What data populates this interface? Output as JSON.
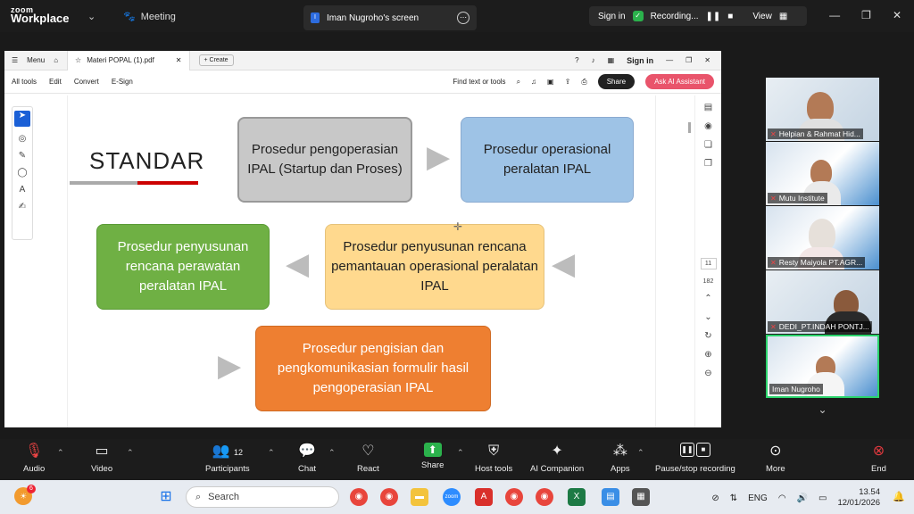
{
  "zoom": {
    "logo_top": "zoom",
    "logo_bottom": "Workplace",
    "meeting_label": "Meeting",
    "screen_tab_label": "Iman Nugroho's screen",
    "signin": "Sign in",
    "recording": "Recording...",
    "view": "View"
  },
  "pdf": {
    "menu": "Menu",
    "tab_name": "Materi POPAL (1).pdf",
    "create": "Create",
    "signin": "Sign in",
    "menus": [
      "All tools",
      "Edit",
      "Convert",
      "E-Sign"
    ],
    "find": "Find text or tools",
    "share": "Share",
    "ai": "Ask AI Assistant",
    "page_current": "11",
    "page_total": "182"
  },
  "slide": {
    "title": "STANDAR",
    "box1": "Prosedur pengoperasian IPAL (Startup dan Proses)",
    "box2": "Prosedur operasional peralatan IPAL",
    "box3": "Prosedur penyusunan rencana pemantauan operasional peralatan IPAL",
    "box4": "Prosedur penyusunan rencana perawatan peralatan IPAL",
    "box5": "Prosedur pengisian dan pengkomunikasian formulir hasil pengoperasian IPAL"
  },
  "participants": [
    {
      "name": "Helpian & Rahmat Hid...",
      "muted": true
    },
    {
      "name": "Mutu Institute",
      "muted": true
    },
    {
      "name": "Resty Maiyola PT.AGR...",
      "muted": true
    },
    {
      "name": "DEDI_PT.INDAH PONTJ...",
      "muted": true
    },
    {
      "name": "Iman Nugroho",
      "muted": false
    }
  ],
  "toolbar": {
    "audio": "Audio",
    "video": "Video",
    "participants": "Participants",
    "participants_count": "12",
    "chat": "Chat",
    "react": "React",
    "share": "Share",
    "host_tools": "Host tools",
    "ai_companion": "AI Companion",
    "apps": "Apps",
    "pause_recording": "Pause/stop recording",
    "more": "More",
    "end": "End"
  },
  "taskbar": {
    "search": "Search",
    "weather_badge": "6",
    "language": "ENG",
    "time": "13.54",
    "date": "12/01/2026"
  }
}
